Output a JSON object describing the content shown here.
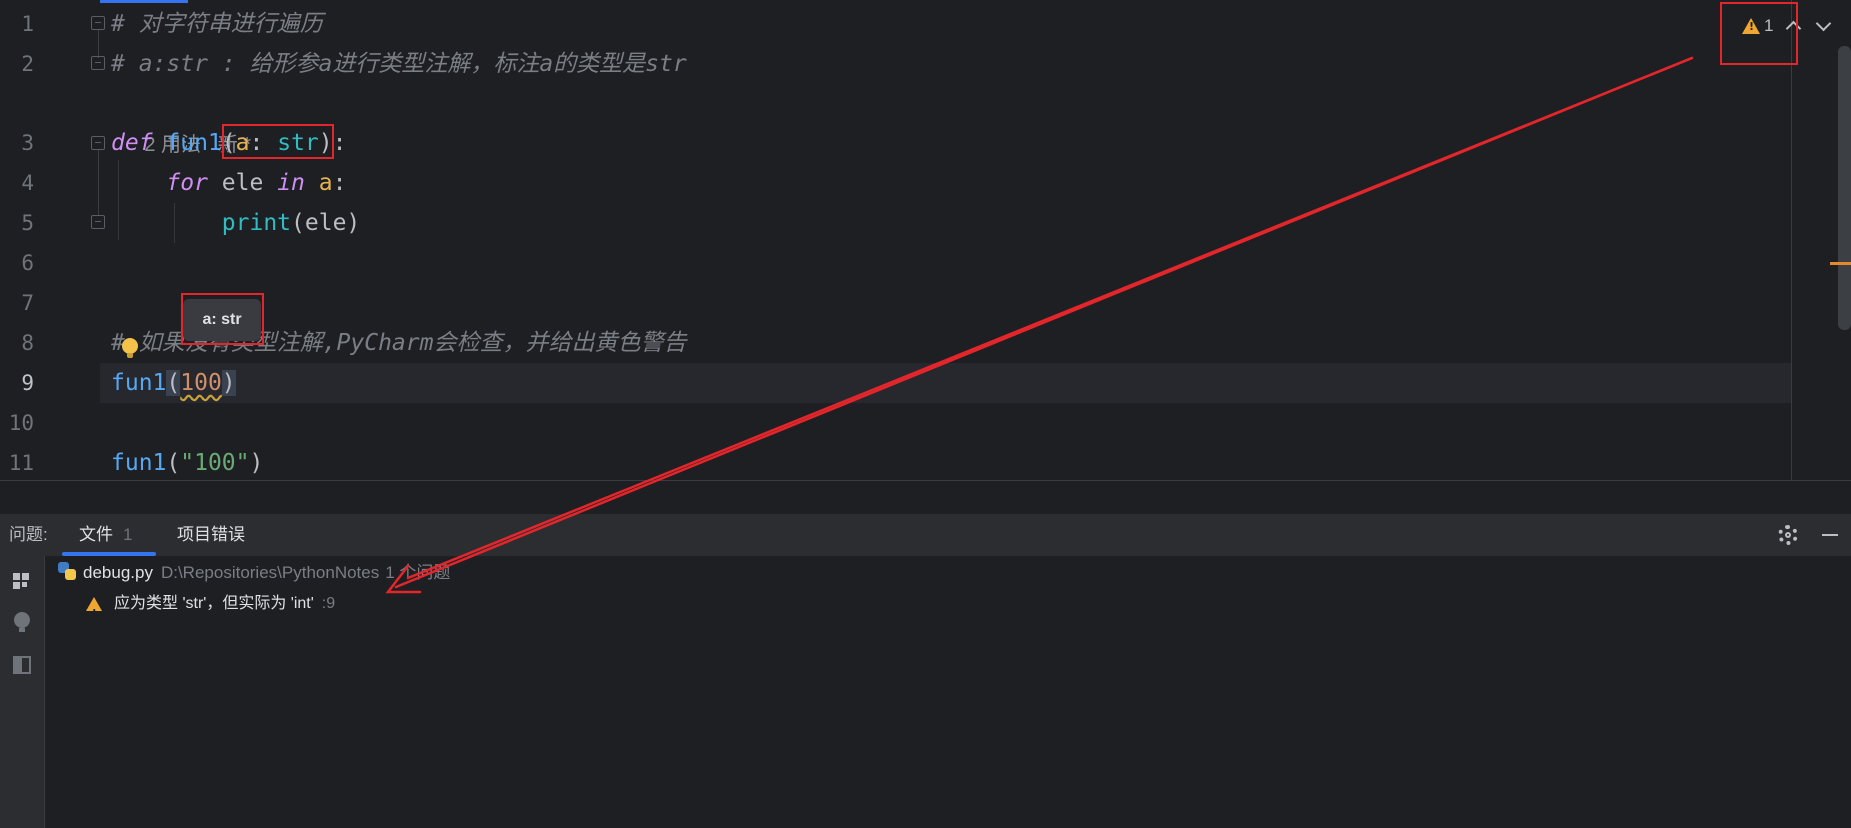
{
  "editor": {
    "line_numbers": [
      "1",
      "2",
      "3",
      "4",
      "5",
      "6",
      "7",
      "8",
      "9",
      "10",
      "11"
    ],
    "lines": {
      "l1": "# 对字符串进行遍历",
      "l2": "# a:str : 给形参a进行类型注解，标注a的类型是str",
      "inlay_usages": "2 用法",
      "inlay_new": "新 *",
      "l3_def": "def",
      "l3_fn": "fun1",
      "l3_open": "(",
      "l3_param": "a",
      "l3_colon": ": ",
      "l3_type": "str",
      "l3_close": "):",
      "l4_for": "for",
      "l4_ele": " ele ",
      "l4_in": "in",
      "l4_a": " a",
      "l4_colon": ":",
      "l5_print": "print",
      "l5_args": "(ele)",
      "l8": "# 如果没有类型注解,PyCharm会检查，并给出黄色警告",
      "l9_fn": "fun1",
      "l9_open": "(",
      "l9_num": "100",
      "l9_close": ")",
      "l11_fn": "fun1",
      "l11_open": "(",
      "l11_str": "\"100\"",
      "l11_close": ")"
    },
    "tooltip": "a: str",
    "inspection_count": "1"
  },
  "problems": {
    "title": "问题:",
    "tabs": [
      {
        "label": "文件",
        "count": "1"
      },
      {
        "label": "项目错误"
      }
    ],
    "file": {
      "name": "debug.py",
      "path": "D:\\Repositories\\PythonNotes",
      "count": "1 个问题"
    },
    "items": [
      {
        "message": "应为类型 'str'，但实际为 'int'",
        "line": ":9"
      }
    ]
  },
  "colors": {
    "accent": "#3574f0",
    "warning": "#f0a732",
    "annotation_red": "#e3262b"
  }
}
